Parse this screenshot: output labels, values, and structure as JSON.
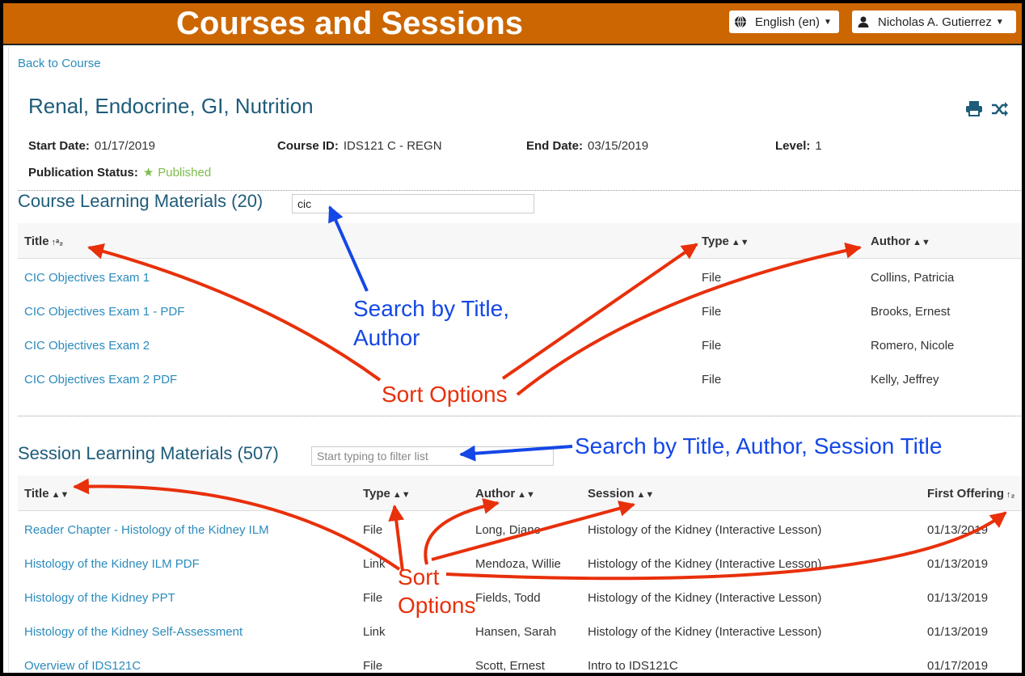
{
  "header": {
    "app_title": "Courses and Sessions",
    "language": "English (en)",
    "user": "Nicholas A. Gutierrez"
  },
  "nav": {
    "back_link": "Back to Course"
  },
  "course": {
    "title": "Renal, Endocrine, GI, Nutrition",
    "start_date_label": "Start Date:",
    "start_date": "01/17/2019",
    "course_id_label": "Course ID:",
    "course_id": "IDS121 C - REGN",
    "end_date_label": "End Date:",
    "end_date": "03/15/2019",
    "level_label": "Level:",
    "level": "1",
    "pub_status_label": "Publication Status:",
    "pub_status": "Published"
  },
  "course_materials": {
    "heading": "Course Learning Materials (20)",
    "filter_value": "cic",
    "columns": [
      "Title",
      "Type",
      "Author"
    ],
    "rows": [
      {
        "title": "CIC Objectives Exam 1",
        "type": "File",
        "author": "Collins, Patricia"
      },
      {
        "title": "CIC Objectives Exam 1 - PDF",
        "type": "File",
        "author": "Brooks, Ernest"
      },
      {
        "title": "CIC Objectives Exam 2",
        "type": "File",
        "author": "Romero, Nicole"
      },
      {
        "title": "CIC Objectives Exam 2 PDF",
        "type": "File",
        "author": "Kelly, Jeffrey"
      }
    ]
  },
  "session_materials": {
    "heading": "Session Learning Materials (507)",
    "filter_placeholder": "Start typing to filter list",
    "columns": [
      "Title",
      "Type",
      "Author",
      "Session",
      "First Offering"
    ],
    "rows": [
      {
        "title": "Reader Chapter - Histology of the Kidney ILM",
        "type": "File",
        "author": "Long, Diane",
        "session": "Histology of the Kidney (Interactive Lesson)",
        "first_offering": "01/13/2019"
      },
      {
        "title": "Histology of the Kidney ILM PDF",
        "type": "Link",
        "author": "Mendoza, Willie",
        "session": "Histology of the Kidney (Interactive Lesson)",
        "first_offering": "01/13/2019"
      },
      {
        "title": "Histology of the Kidney PPT",
        "type": "File",
        "author": "Fields, Todd",
        "session": "Histology of the Kidney (Interactive Lesson)",
        "first_offering": "01/13/2019"
      },
      {
        "title": "Histology of the Kidney Self-Assessment",
        "type": "Link",
        "author": "Hansen, Sarah",
        "session": "Histology of the Kidney (Interactive Lesson)",
        "first_offering": "01/13/2019"
      },
      {
        "title": "Overview of IDS121C",
        "type": "File",
        "author": "Scott, Ernest",
        "session": "Intro to IDS121C",
        "first_offering": "01/17/2019"
      }
    ]
  },
  "annotations": {
    "search_title_author_line1": "Search by Title,",
    "search_title_author_line2": "Author",
    "sort_options_top": "Sort Options",
    "search_session": "Search by Title, Author, Session Title",
    "sort_bottom_line1": "Sort",
    "sort_bottom_line2": "Options"
  },
  "colors": {
    "topbar": "#cc6600",
    "heading": "#1e5c7a",
    "link": "#2b8bbd",
    "published": "#7bbd4a",
    "annotation_red": "#e8300b",
    "annotation_blue": "#1447e6"
  }
}
